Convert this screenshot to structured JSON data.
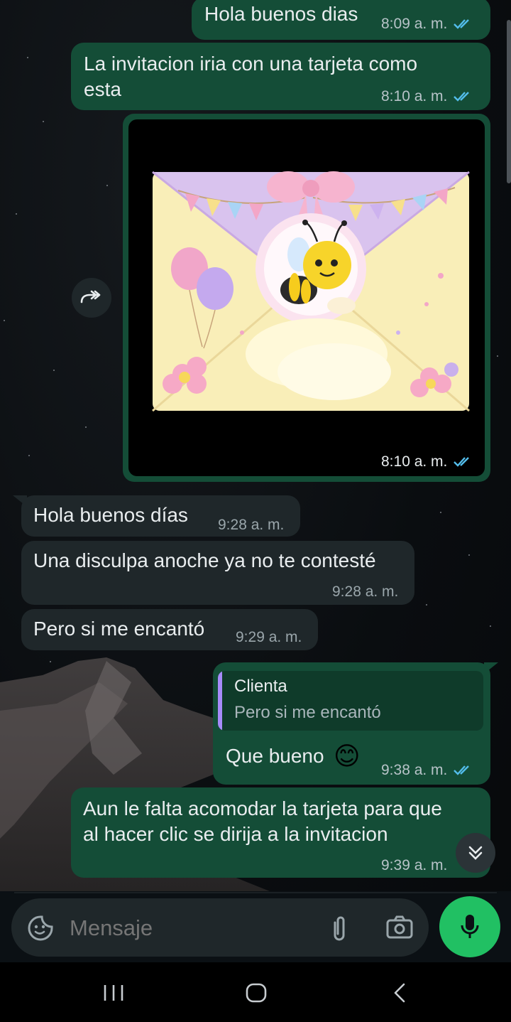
{
  "messages": [
    {
      "id": "m1",
      "direction": "out",
      "text": "Hola buenos dias",
      "time": "8:09 a. m."
    },
    {
      "id": "m2",
      "direction": "out",
      "text_line1": "La invitacion iria con una tarjeta como",
      "text_line2": "esta",
      "time": "8:10 a. m."
    },
    {
      "id": "m3",
      "direction": "out",
      "type": "image",
      "time": "8:10 a. m."
    },
    {
      "id": "m4",
      "direction": "in",
      "text": "Hola buenos días",
      "time": "9:28 a. m."
    },
    {
      "id": "m5",
      "direction": "in",
      "text": "Una disculpa anoche ya no te contesté",
      "time": "9:28 a. m."
    },
    {
      "id": "m6",
      "direction": "in",
      "text": "Pero si me encantó",
      "time": "9:29 a. m."
    },
    {
      "id": "m7",
      "direction": "out",
      "quote_author": "Clienta",
      "quote_text": "Pero si me encantó",
      "text": "Que bueno",
      "emoji": "😊",
      "time": "9:38 a. m."
    },
    {
      "id": "m8",
      "direction": "out",
      "text_line1": "Aun le falta acomodar la tarjeta para que",
      "text_line2": "al hacer clic se dirija a la invitacion",
      "time": "9:39 a. m."
    }
  ],
  "composer": {
    "placeholder": "Mensaje"
  },
  "colors": {
    "outgoing_bubble": "#144d37",
    "incoming_bubble": "#1f272a",
    "mic_button": "#21c063",
    "read_ticks": "#53bdeb"
  },
  "icons": {
    "forward": "forward-icon",
    "sticker": "sticker-icon",
    "attach": "paperclip-icon",
    "camera": "camera-icon",
    "mic": "mic-icon",
    "scroll_down": "double-chevron-down-icon",
    "nav_recents": "recents-icon",
    "nav_home": "home-icon",
    "nav_back": "back-icon"
  }
}
